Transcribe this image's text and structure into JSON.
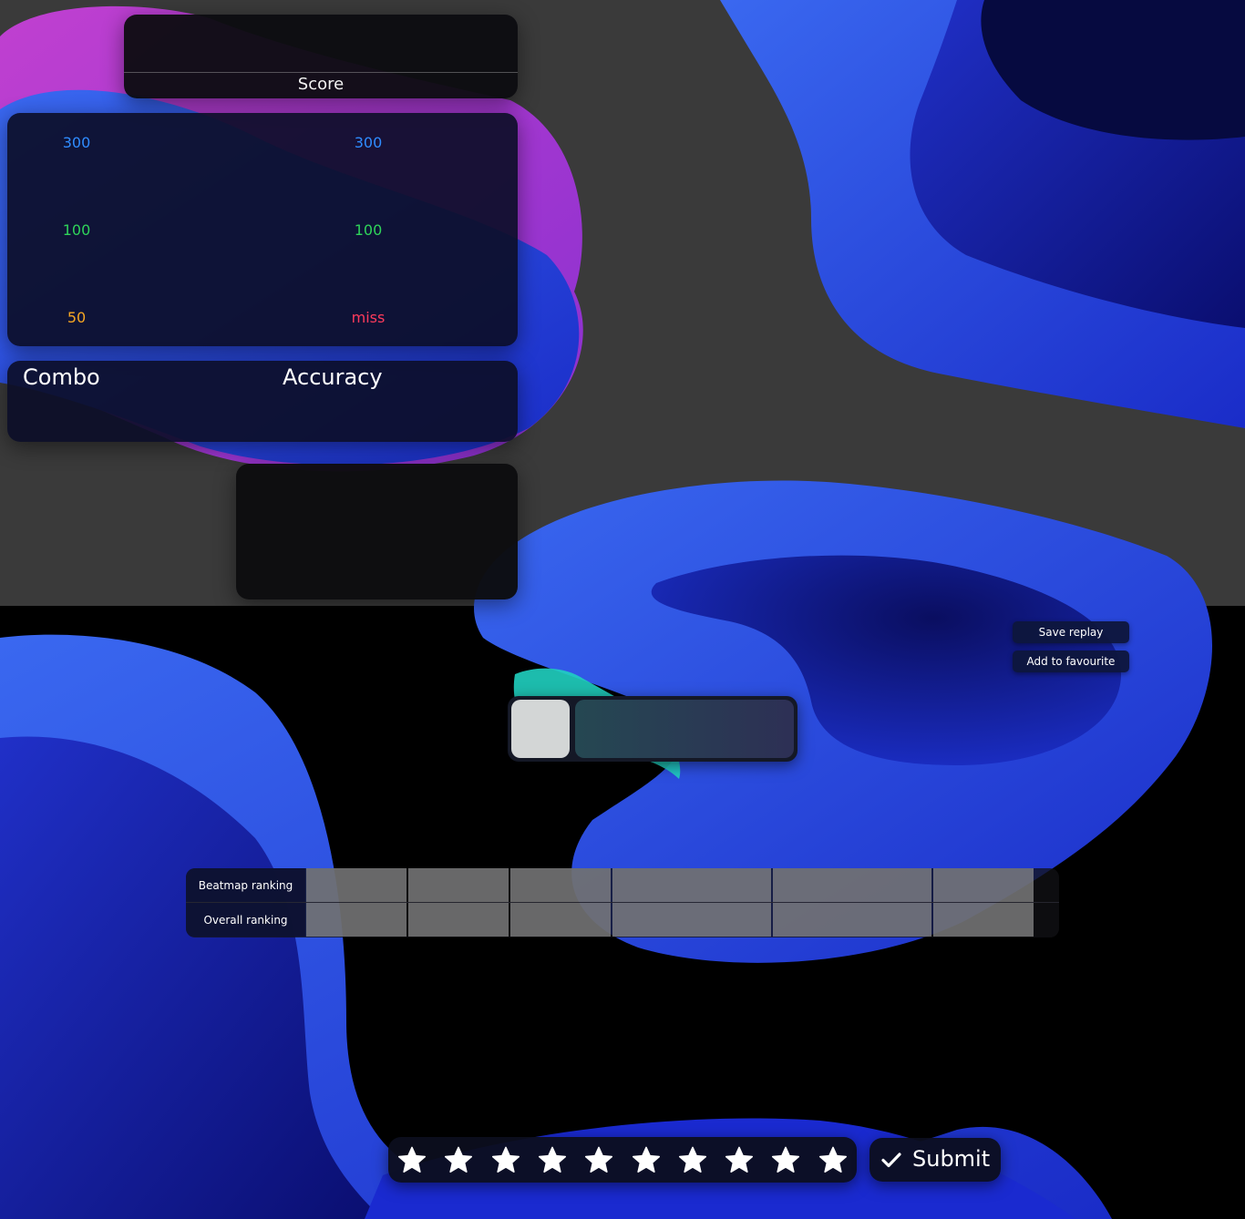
{
  "score_panel": {
    "label": "Score"
  },
  "hits": {
    "left": [
      {
        "label": "300",
        "color": "#2f8cff"
      },
      {
        "label": "100",
        "color": "#2fd35a"
      },
      {
        "label": "50",
        "color": "#f5a623"
      }
    ],
    "right": [
      {
        "label": "300",
        "color": "#2f8cff"
      },
      {
        "label": "100",
        "color": "#2fd35a"
      },
      {
        "label": "miss",
        "color": "#ff3b5c"
      }
    ]
  },
  "stats": {
    "combo_label": "Combo",
    "accuracy_label": "Accuracy"
  },
  "actions": {
    "save_replay": "Save replay",
    "add_favourite": "Add to favourite"
  },
  "ranking": {
    "beatmap_label": "Beatmap ranking",
    "overall_label": "Overall ranking"
  },
  "rating": {
    "star_count": 10,
    "submit_label": "Submit"
  },
  "colors": {
    "top_bg": "#3a3a3a",
    "bottom_bg": "#000000",
    "blob_blue": "#2a4fe0",
    "blob_purple": "#b040d0",
    "blob_teal": "#20d0c0"
  }
}
